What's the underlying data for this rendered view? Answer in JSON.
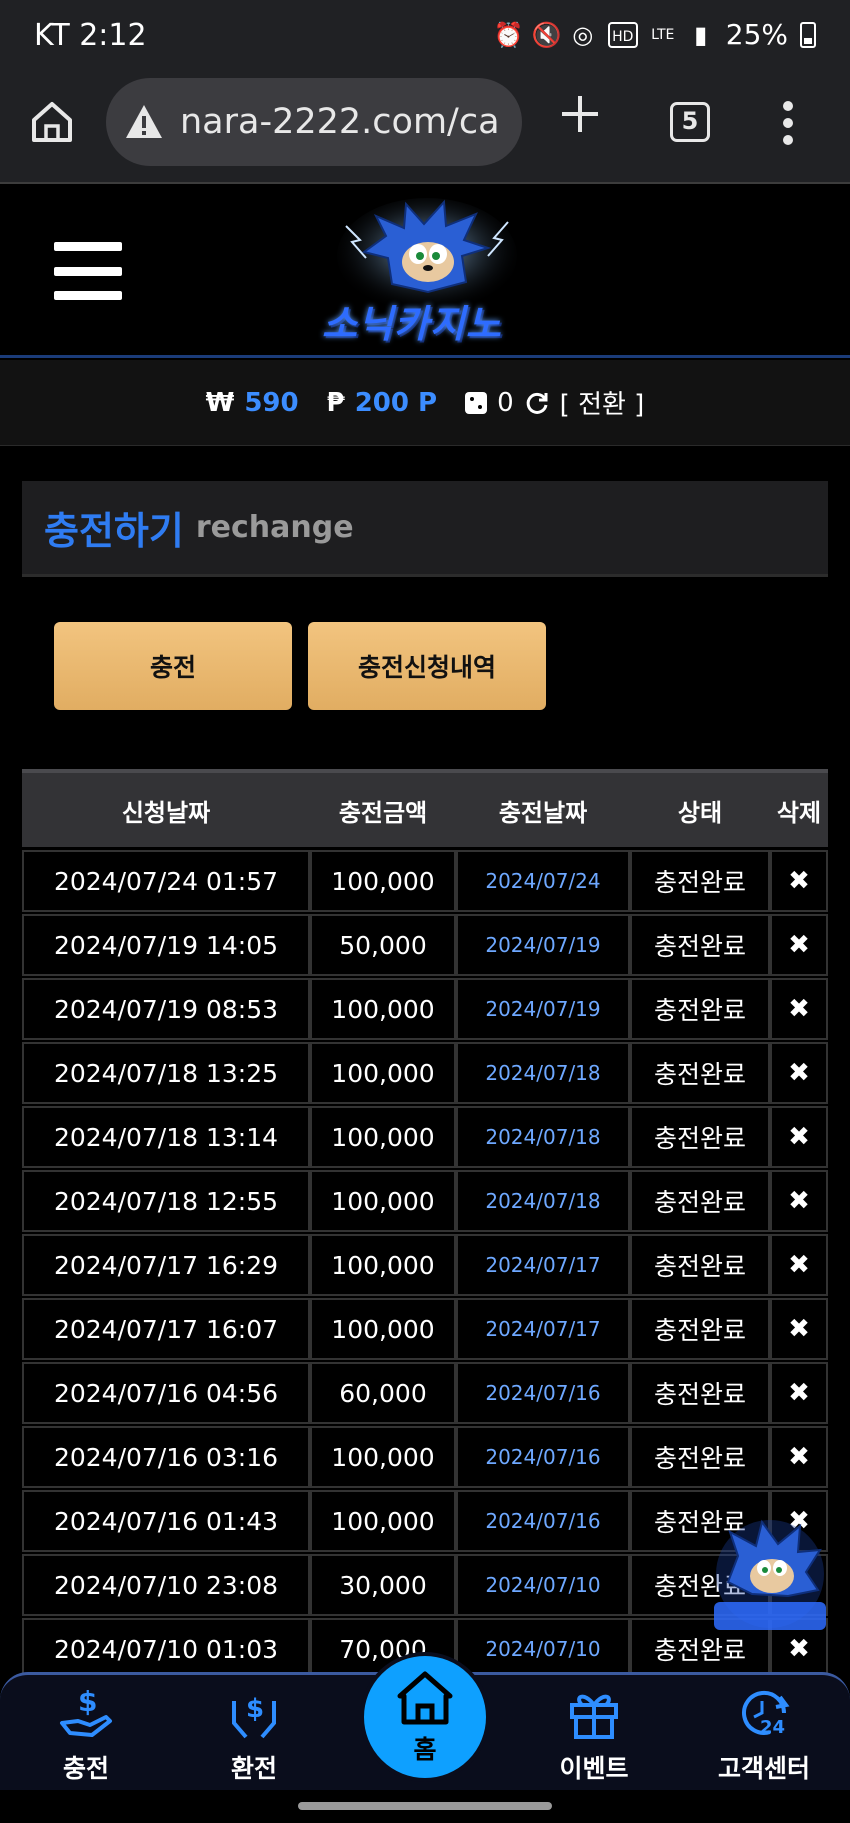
{
  "status_bar": {
    "carrier_time": "KT 2:12",
    "battery": "25%"
  },
  "browser": {
    "url": "nara-2222.com/ca",
    "tab_count": "5"
  },
  "site": {
    "logo_text": "소닉카지노"
  },
  "balance": {
    "won_symbol": "₩",
    "won_value": "590",
    "point_symbol": "₱",
    "point_value": "200 P",
    "chip_value": "0",
    "switch_label": "[ 전환 ]"
  },
  "section": {
    "title_ko": "충전하기",
    "title_en": "rechange"
  },
  "buttons": {
    "charge": "충전",
    "history": "충전신청내역"
  },
  "table": {
    "headers": [
      "신청날짜",
      "충전금액",
      "충전날짜",
      "상태",
      "삭제"
    ],
    "rows": [
      [
        "2024/07/24 01:57",
        "100,000",
        "2024/07/24",
        "충전완료",
        "✖"
      ],
      [
        "2024/07/19 14:05",
        "50,000",
        "2024/07/19",
        "충전완료",
        "✖"
      ],
      [
        "2024/07/19 08:53",
        "100,000",
        "2024/07/19",
        "충전완료",
        "✖"
      ],
      [
        "2024/07/18 13:25",
        "100,000",
        "2024/07/18",
        "충전완료",
        "✖"
      ],
      [
        "2024/07/18 13:14",
        "100,000",
        "2024/07/18",
        "충전완료",
        "✖"
      ],
      [
        "2024/07/18 12:55",
        "100,000",
        "2024/07/18",
        "충전완료",
        "✖"
      ],
      [
        "2024/07/17 16:29",
        "100,000",
        "2024/07/17",
        "충전완료",
        "✖"
      ],
      [
        "2024/07/17 16:07",
        "100,000",
        "2024/07/17",
        "충전완료",
        "✖"
      ],
      [
        "2024/07/16 04:56",
        "60,000",
        "2024/07/16",
        "충전완료",
        "✖"
      ],
      [
        "2024/07/16 03:16",
        "100,000",
        "2024/07/16",
        "충전완료",
        "✖"
      ],
      [
        "2024/07/16 01:43",
        "100,000",
        "2024/07/16",
        "충전완료",
        "✖"
      ],
      [
        "2024/07/10 23:08",
        "30,000",
        "2024/07/10",
        "충전완료",
        "✖"
      ],
      [
        "2024/07/10 01:03",
        "70,000",
        "2024/07/10",
        "충전완료",
        "✖"
      ]
    ]
  },
  "bottom_nav": {
    "charge": "충전",
    "exchange": "환전",
    "home": "홈",
    "event": "이벤트",
    "support": "고객센터"
  },
  "colors": {
    "accent_blue": "#2f7cf2",
    "gold_button": "#e8b86d",
    "home_circle": "#0ea0ff"
  }
}
